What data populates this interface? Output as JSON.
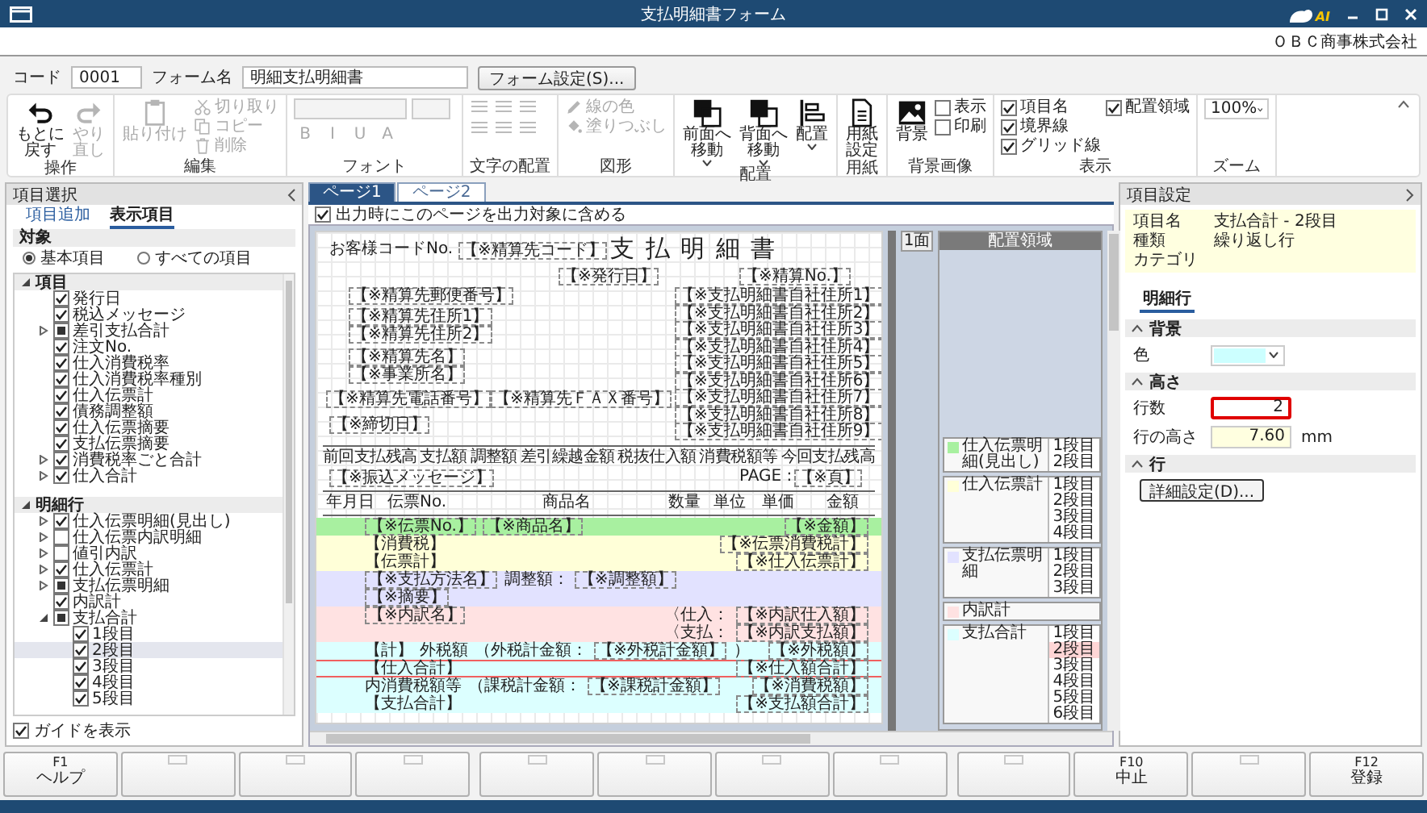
{
  "window": {
    "title": "支払明細書フォーム",
    "logo_text": "AI",
    "company": "ＯＢＣ商事株式会社"
  },
  "form_bar": {
    "code_label": "コード",
    "code": "0001",
    "name_label": "フォーム名",
    "name": "明細支払明細書",
    "settings_button": "フォーム設定(S)..."
  },
  "ribbon": [
    {
      "label": "操作",
      "items": [
        {
          "kind": "large",
          "lines": [
            "もとに",
            "戻す"
          ],
          "disabled": false
        },
        {
          "kind": "large",
          "lines": [
            "やり",
            "直し"
          ],
          "disabled": true
        }
      ]
    },
    {
      "label": "編集",
      "items": [
        {
          "kind": "large",
          "lines": [
            "貼り付け"
          ],
          "disabled": true
        },
        {
          "kind": "small",
          "label": "切り取り",
          "disabled": true
        },
        {
          "kind": "small",
          "label": "コピー",
          "disabled": true
        },
        {
          "kind": "small",
          "label": "削除",
          "disabled": true
        }
      ]
    },
    {
      "label": "フォント",
      "items": [
        {
          "kind": "select",
          "disabled": true
        },
        {
          "kind": "select",
          "disabled": true
        },
        {
          "kind": "format",
          "label": "B",
          "disabled": true
        },
        {
          "kind": "format",
          "label": "I",
          "disabled": true
        },
        {
          "kind": "format",
          "label": "U",
          "disabled": true
        },
        {
          "kind": "format",
          "label": "A",
          "disabled": true
        }
      ]
    },
    {
      "label": "文字の配置",
      "items": [
        {
          "kind": "align",
          "disabled": true
        },
        {
          "kind": "align",
          "disabled": true
        },
        {
          "kind": "align",
          "disabled": true
        },
        {
          "kind": "align",
          "disabled": true
        },
        {
          "kind": "align",
          "disabled": true
        },
        {
          "kind": "align",
          "disabled": true
        }
      ]
    },
    {
      "label": "図形",
      "items": [
        {
          "kind": "small",
          "label": "線の色",
          "disabled": true
        },
        {
          "kind": "small",
          "label": "塗りつぶし",
          "disabled": true
        }
      ]
    },
    {
      "label": "配置",
      "items": [
        {
          "kind": "large",
          "lines": [
            "前面へ",
            "移動"
          ],
          "menu": true,
          "disabled": false
        },
        {
          "kind": "large",
          "lines": [
            "背面へ",
            "移動"
          ],
          "menu": true,
          "disabled": false
        },
        {
          "kind": "large",
          "lines": [
            "配置"
          ],
          "menu": true,
          "disabled": false
        }
      ]
    },
    {
      "label": "用紙",
      "items": [
        {
          "kind": "large",
          "lines": [
            "用紙",
            "設定"
          ],
          "disabled": false
        }
      ]
    },
    {
      "label": "背景画像",
      "items": [
        {
          "kind": "large",
          "lines": [
            "背景"
          ],
          "disabled": false
        },
        {
          "kind": "check",
          "label": "表示",
          "checked": false
        },
        {
          "kind": "check",
          "label": "印刷",
          "checked": false
        }
      ]
    },
    {
      "label": "表示",
      "items": [
        {
          "kind": "check",
          "label": "項目名",
          "checked": true
        },
        {
          "kind": "check",
          "label": "境界線",
          "checked": true
        },
        {
          "kind": "check",
          "label": "グリッド線",
          "checked": true
        },
        {
          "kind": "check",
          "label": "配置領域",
          "checked": true
        }
      ]
    },
    {
      "label": "ズーム",
      "items": [
        {
          "kind": "select",
          "value": "100%",
          "disabled": false
        }
      ]
    }
  ],
  "left_panel": {
    "title": "項目選択",
    "tabs": [
      {
        "label": "項目追加",
        "selected": false
      },
      {
        "label": "表示項目",
        "selected": true
      }
    ],
    "section": "対象",
    "radios": [
      {
        "label": "基本項目",
        "selected": true
      },
      {
        "label": "すべての項目",
        "selected": false
      }
    ],
    "tree": [
      {
        "label": "項目",
        "expanded": true,
        "children": [
          {
            "label": "発行日",
            "checked": true
          },
          {
            "label": "税込メッセージ",
            "checked": true
          },
          {
            "label": "差引支払合計",
            "indeterminate": true,
            "expanded": false
          },
          {
            "label": "注文No.",
            "checked": true
          },
          {
            "label": "仕入消費税率",
            "checked": true
          },
          {
            "label": "仕入消費税率種別",
            "checked": true
          },
          {
            "label": "仕入伝票計",
            "checked": true
          },
          {
            "label": "債務調整額",
            "checked": true
          },
          {
            "label": "仕入伝票摘要",
            "checked": true
          },
          {
            "label": "支払伝票摘要",
            "checked": true
          },
          {
            "label": "消費税率ごと合計",
            "checked": true,
            "expanded": false
          },
          {
            "label": "仕入合計",
            "checked": true,
            "expanded": false
          }
        ]
      },
      {
        "label": "明細行",
        "expanded": true,
        "children": [
          {
            "label": "仕入伝票明細(見出し)",
            "checked": true,
            "expanded": false
          },
          {
            "label": "仕入伝票内訳明細",
            "checked": false,
            "expanded": false
          },
          {
            "label": "値引内訳",
            "checked": false,
            "expanded": false
          },
          {
            "label": "仕入伝票計",
            "checked": true,
            "expanded": false
          },
          {
            "label": "支払伝票明細",
            "indeterminate": true,
            "expanded": false
          },
          {
            "label": "内訳計",
            "checked": true
          },
          {
            "label": "支払合計",
            "indeterminate": true,
            "expanded": true,
            "children": [
              {
                "label": "1段目",
                "checked": true,
                "selected": false
              },
              {
                "label": "2段目",
                "checked": true,
                "selected": true
              },
              {
                "label": "3段目",
                "checked": true,
                "selected": false
              },
              {
                "label": "4段目",
                "checked": true,
                "selected": false
              },
              {
                "label": "5段目",
                "checked": true,
                "selected": false
              }
            ]
          }
        ]
      }
    ],
    "guide": {
      "label": "ガイドを表示",
      "checked": true
    }
  },
  "designer": {
    "page_tabs": [
      {
        "label": "ページ1",
        "selected": true
      },
      {
        "label": "ページ2",
        "selected": false
      }
    ],
    "include_page": {
      "label": "出力時にこのページを出力対象に含める",
      "checked": true
    },
    "document": {
      "title": "支 払 明 細 書",
      "header": [
        {
          "kind": "label",
          "text": "お客様コードNo."
        },
        {
          "kind": "field",
          "text": "【※精算先コード】"
        },
        {
          "kind": "field",
          "text": "【※発行日】"
        },
        {
          "kind": "field",
          "text": "【※精算No.】"
        },
        {
          "kind": "field",
          "text": "【※精算先郵便番号】"
        },
        {
          "kind": "field",
          "text": "【※精算先住所1】"
        },
        {
          "kind": "field",
          "text": "【※精算先住所2】"
        },
        {
          "kind": "field",
          "text": "【※精算先名】"
        },
        {
          "kind": "field",
          "text": "【※事業所名】"
        },
        {
          "kind": "field",
          "text": "【※精算先電話番号】"
        },
        {
          "kind": "field",
          "text": "【※精算先ＦＡＸ番号】"
        },
        {
          "kind": "field",
          "text": "【※支払明細書自社住所1】"
        },
        {
          "kind": "field",
          "text": "【※支払明細書自社住所2】"
        },
        {
          "kind": "field",
          "text": "【※支払明細書自社住所3】"
        },
        {
          "kind": "field",
          "text": "【※支払明細書自社住所4】"
        },
        {
          "kind": "field",
          "text": "【※支払明細書自社住所5】"
        },
        {
          "kind": "field",
          "text": "【※支払明細書自社住所6】"
        },
        {
          "kind": "field",
          "text": "【※支払明細書自社住所7】"
        },
        {
          "kind": "field",
          "text": "【※支払明細書自社住所8】"
        },
        {
          "kind": "field",
          "text": "【※支払明細書自社住所9】"
        },
        {
          "kind": "field",
          "text": "【※締切日】"
        },
        {
          "kind": "field",
          "text": "【※振込メッセージ】"
        },
        {
          "kind": "label",
          "text": "PAGE :"
        },
        {
          "kind": "field",
          "text": "【※頁】"
        }
      ],
      "summary_columns": [
        "前回支払残高",
        "支払額",
        "調整額",
        "差引繰越金額",
        "税抜仕入額",
        "消費税額等",
        "今回支払残高"
      ],
      "columns": [
        "年月日",
        "伝票No.",
        "商品名",
        "数量",
        "単位",
        "単価",
        "金額"
      ]
    },
    "side_tab": "1面",
    "area_title": "配置領域",
    "bands": [
      {
        "name": "仕入伝票明細(見出し)",
        "color": "#a8f0a0",
        "rows": [
          {
            "label": "1段目",
            "selected": false
          },
          {
            "label": "2段目",
            "selected": false
          }
        ],
        "lines": [
          [
            {
              "kind": "field",
              "text": "【※伝票No.】"
            },
            {
              "kind": "field",
              "text": "【※商品名】"
            },
            {
              "kind": "amount",
              "text": "【※金額】"
            }
          ]
        ]
      },
      {
        "name": "仕入伝票計",
        "color": "#ffffd8",
        "rows": [
          {
            "label": "1段目",
            "selected": false
          },
          {
            "label": "2段目",
            "selected": false
          },
          {
            "label": "3段目",
            "selected": false
          },
          {
            "label": "4段目",
            "selected": false
          }
        ],
        "lines": [
          [
            {
              "kind": "label",
              "text": "【消費税】"
            },
            {
              "kind": "amount",
              "text": "【※伝票消費税計】"
            }
          ],
          [
            {
              "kind": "label",
              "text": "【伝票計】"
            },
            {
              "kind": "amount",
              "text": "【※仕入伝票計】"
            }
          ]
        ]
      },
      {
        "name": "支払伝票明細",
        "color": "#e2e2ff",
        "rows": [
          {
            "label": "1段目",
            "selected": false
          },
          {
            "label": "2段目",
            "selected": false
          },
          {
            "label": "3段目",
            "selected": false
          }
        ],
        "lines": [
          [
            {
              "kind": "field",
              "text": "【※支払方法名】"
            },
            {
              "kind": "label",
              "text": "調整額："
            },
            {
              "kind": "field",
              "text": "【※調整額】"
            }
          ],
          [
            {
              "kind": "field",
              "text": "【※摘要】"
            }
          ]
        ]
      },
      {
        "name": "内訳計",
        "color": "#ffe2e2",
        "lines": [
          [
            {
              "kind": "field",
              "text": "【※内訳名】"
            },
            {
              "kind": "prefix",
              "text": "〈仕入："
            },
            {
              "kind": "amount",
              "text": "【※内訳仕入額】"
            }
          ],
          [
            {
              "kind": "prefix",
              "text": "〈支払："
            },
            {
              "kind": "amount",
              "text": "【※内訳支払額】"
            }
          ]
        ]
      },
      {
        "name": "支払合計",
        "color": "#dcffff",
        "rows": [
          {
            "label": "1段目",
            "selected": false
          },
          {
            "label": "2段目",
            "selected": true
          },
          {
            "label": "3段目",
            "selected": false
          },
          {
            "label": "4段目",
            "selected": false
          },
          {
            "label": "5段目",
            "selected": false
          },
          {
            "label": "6段目",
            "selected": false
          }
        ],
        "lines": [
          [
            {
              "kind": "label",
              "text": "【計】"
            },
            {
              "kind": "label",
              "text": "外税額"
            },
            {
              "kind": "label",
              "text": "（外税計金額："
            },
            {
              "kind": "field",
              "text": "【※外税計金額】"
            },
            {
              "kind": "label",
              "text": "）"
            },
            {
              "kind": "amount",
              "text": "【※外税額】"
            }
          ],
          [
            {
              "kind": "label",
              "text": "【仕入合計】"
            },
            {
              "kind": "amount",
              "text": "【※仕入額合計】"
            }
          ],
          [
            {
              "kind": "label",
              "text": "内消費税額等"
            },
            {
              "kind": "label",
              "text": "（課税計金額："
            },
            {
              "kind": "field",
              "text": "【※課税計金額】"
            },
            {
              "kind": "amount",
              "text": "【※消費税額】"
            }
          ],
          [
            {
              "kind": "label",
              "text": "【支払合計】"
            },
            {
              "kind": "amount",
              "text": "【※支払額合計】"
            }
          ]
        ]
      }
    ]
  },
  "right_panel": {
    "title": "項目設定",
    "info": [
      {
        "label": "項目名",
        "value": "支払合計 - 2段目"
      },
      {
        "label": "種類",
        "value": "繰り返し行"
      },
      {
        "label": "カテゴリ"
      }
    ],
    "tabs": [
      {
        "label": "明細行",
        "selected": true
      }
    ],
    "sections": [
      {
        "title": "背景",
        "fields": [
          {
            "kind": "color",
            "label": "色",
            "color": "#ccffff"
          }
        ]
      },
      {
        "title": "高さ",
        "fields": [
          {
            "kind": "number",
            "label": "行数",
            "value": "2",
            "focused": true,
            "readonly": false
          },
          {
            "kind": "number",
            "label": "行の高さ",
            "value": "7.60",
            "unit": "mm",
            "focused": false,
            "readonly": true
          }
        ]
      },
      {
        "title": "行",
        "fields": [
          {
            "kind": "button",
            "label": "詳細設定(D)..."
          }
        ]
      }
    ]
  },
  "function_keys": [
    {
      "kind": "command",
      "key": "F1",
      "label": "ヘルプ"
    },
    {
      "kind": "blank"
    },
    {
      "kind": "blank"
    },
    {
      "kind": "blank"
    },
    {
      "kind": "blank"
    },
    {
      "kind": "blank"
    },
    {
      "kind": "blank"
    },
    {
      "kind": "blank"
    },
    {
      "kind": "blank"
    },
    {
      "kind": "command",
      "key": "F10",
      "label": "中止"
    },
    {
      "kind": "blank"
    },
    {
      "kind": "command",
      "key": "F12",
      "label": "登録"
    }
  ]
}
